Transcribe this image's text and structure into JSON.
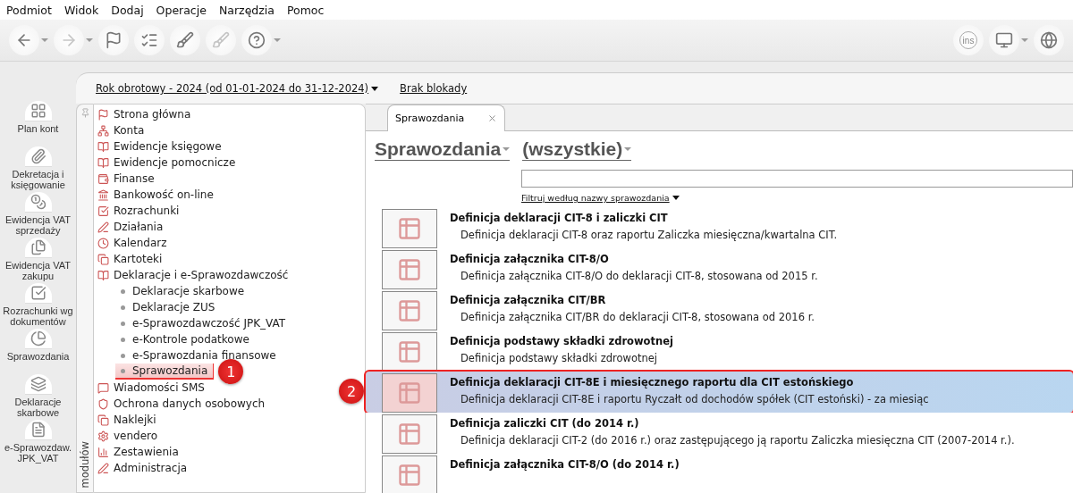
{
  "menu": [
    {
      "label": "Podmiot"
    },
    {
      "label": "Widok"
    },
    {
      "label": "Dodaj"
    },
    {
      "label": "Operacje"
    },
    {
      "label": "Narzędzia"
    },
    {
      "label": "Pomoc"
    }
  ],
  "toolbar": [
    {
      "kind": "back",
      "dropdown": true,
      "disabled": false
    },
    {
      "kind": "forward",
      "dropdown": true,
      "disabled": true
    },
    {
      "kind": "flag",
      "dropdown": false,
      "disabled": false
    },
    {
      "kind": "checklist",
      "dropdown": false,
      "disabled": false
    },
    {
      "kind": "brush",
      "dropdown": false,
      "disabled": false
    },
    {
      "kind": "brush",
      "dropdown": false,
      "disabled": true
    },
    {
      "kind": "help",
      "dropdown": true,
      "disabled": false
    }
  ],
  "toolbar_right": [
    {
      "kind": "ins",
      "label": "ins",
      "dropdown": false
    },
    {
      "kind": "monitor",
      "dropdown": true
    },
    {
      "kind": "globe",
      "dropdown": false
    }
  ],
  "period": {
    "label": "Rok obrotowy - 2024  (od 01-01-2024 do 31-12-2024)",
    "lock": "Brak blokady"
  },
  "quick_bar": [
    {
      "label": "Plan kont"
    },
    {
      "label": "Dekretacja i księgowanie"
    },
    {
      "label": "Ewidencja VAT sprzedaży"
    },
    {
      "label": "Ewidencja VAT zakupu"
    },
    {
      "label": "Rozrachunki wg dokumentów"
    },
    {
      "label": "Sprawozdania"
    },
    {
      "label": "Deklaracje skarbowe"
    },
    {
      "label": "e-Sprawozdaw. JPK_VAT"
    }
  ],
  "modules_label": "modułów",
  "tree": [
    {
      "label": "Strona główna",
      "selected": false
    },
    {
      "label": "Konta",
      "selected": false
    },
    {
      "label": "Ewidencje księgowe",
      "selected": false
    },
    {
      "label": "Ewidencje pomocnicze",
      "selected": false
    },
    {
      "label": "Finanse",
      "selected": false
    },
    {
      "label": "Bankowość on-line",
      "selected": false
    },
    {
      "label": "Rozrachunki",
      "selected": false
    },
    {
      "label": "Działania",
      "selected": false
    },
    {
      "label": "Kalendarz",
      "selected": false
    },
    {
      "label": "Kartoteki",
      "selected": false
    },
    {
      "label": "Deklaracje i e-Sprawozdawczość",
      "selected": false,
      "children": [
        {
          "label": "Deklaracje skarbowe",
          "selected": false
        },
        {
          "label": "Deklaracje ZUS",
          "selected": false
        },
        {
          "label": "e-Sprawozdawczość JPK_VAT",
          "selected": false
        },
        {
          "label": "e-Kontrole podatkowe",
          "selected": false
        },
        {
          "label": "e-Sprawozdania finansowe",
          "selected": false
        },
        {
          "label": "Sprawozdania",
          "selected": true,
          "callout": "1"
        }
      ]
    },
    {
      "label": "Wiadomości SMS",
      "selected": false
    },
    {
      "label": "Ochrona danych osobowych",
      "selected": false
    },
    {
      "label": "Naklejki",
      "selected": false
    },
    {
      "label": "vendero",
      "selected": false
    },
    {
      "label": "Zestawienia",
      "selected": false
    },
    {
      "label": "Administracja",
      "selected": false
    }
  ],
  "tabs": [
    {
      "label": "Sprawozdania",
      "selected": true
    }
  ],
  "header": {
    "category": "Sprawozdania",
    "filter": "(wszystkie)"
  },
  "search": {
    "filter_label": "Filtruj według nazwy sprawozdania"
  },
  "reports": [
    {
      "title": "Definicja deklaracji CIT-8 i zaliczki CIT",
      "description": "Definicja deklaracji CIT-8 oraz raportu Zaliczka miesięczna/kwartalna CIT.",
      "selected": false
    },
    {
      "title": "Definicja załącznika CIT-8/O",
      "description": "Definicja załącznika CIT-8/O do deklaracji CIT-8, stosowana od 2015 r.",
      "selected": false
    },
    {
      "title": "Definicja załącznika CIT/BR",
      "description": "Definicja załącznika CIT/BR do deklaracji CIT-8, stosowana od 2016 r.",
      "selected": false
    },
    {
      "title": "Definicja podstawy składki zdrowotnej",
      "description": "Definicja podstawy składki zdrowotnej",
      "selected": false
    },
    {
      "title": "Definicja deklaracji CIT-8E i miesięcznego raportu dla CIT estońskiego",
      "description": "Definicja deklaracji CIT-8E i raportu Ryczałt od dochodów spółek (CIT estoński) - za miesiąc",
      "selected": true,
      "callout": "2"
    },
    {
      "title": "Definicja zaliczki CIT (do 2014 r.)",
      "description": "Definicja deklaracji CIT-2 (do 2016 r.) oraz zastępującego ją raportu Zaliczka miesięczna CIT (2007-2014 r.).",
      "selected": false
    },
    {
      "title": "Definicja załącznika CIT-8/O (do 2014 r.)",
      "selected": false
    }
  ]
}
